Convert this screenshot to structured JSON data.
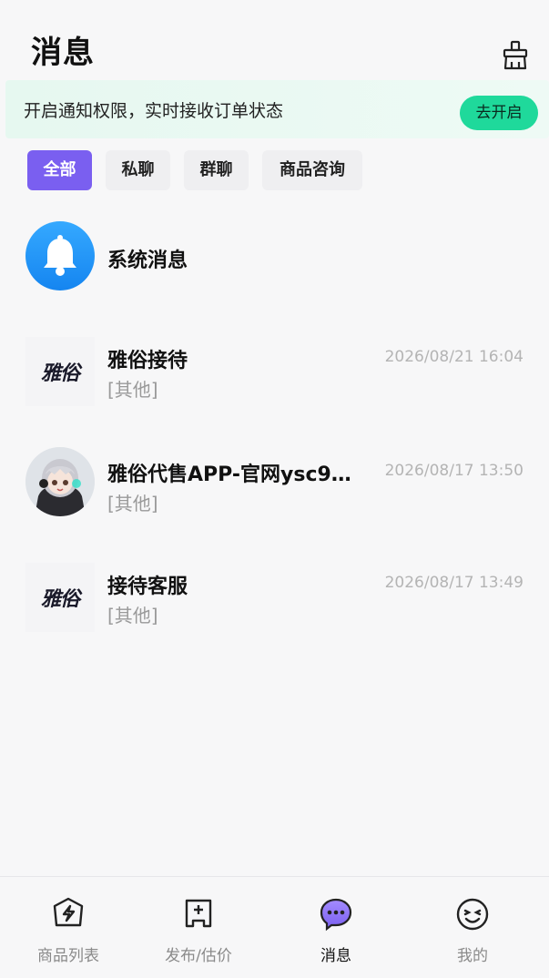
{
  "header": {
    "title": "消息"
  },
  "notice": {
    "text": "开启通知权限，实时接收订单状态",
    "button": "去开启"
  },
  "filters": [
    "全部",
    "私聊",
    "群聊",
    "商品咨询"
  ],
  "system": {
    "title": "系统消息"
  },
  "conversations": [
    {
      "title": "雅俗接待",
      "preview": "[其他]",
      "time": "2026/08/21 16:04",
      "avatar_text": "雅俗"
    },
    {
      "title": "雅俗代售APP-官网ysc9…",
      "preview": "[其他]",
      "time": "2026/08/17 13:50"
    },
    {
      "title": "接待客服",
      "preview": "[其他]",
      "time": "2026/08/17 13:49",
      "avatar_text": "雅俗"
    }
  ],
  "tabs": [
    {
      "label": "商品列表",
      "icon": "bolt-box-icon"
    },
    {
      "label": "发布/估价",
      "icon": "plus-box-icon"
    },
    {
      "label": "消息",
      "icon": "chat-bubble-icon"
    },
    {
      "label": "我的",
      "icon": "smile-face-icon"
    }
  ],
  "colors": {
    "accent": "#7a5ff0",
    "notice_button": "#1fd99b",
    "notice_bg": "#e6f8f0",
    "system_blue": "#1585f0"
  }
}
